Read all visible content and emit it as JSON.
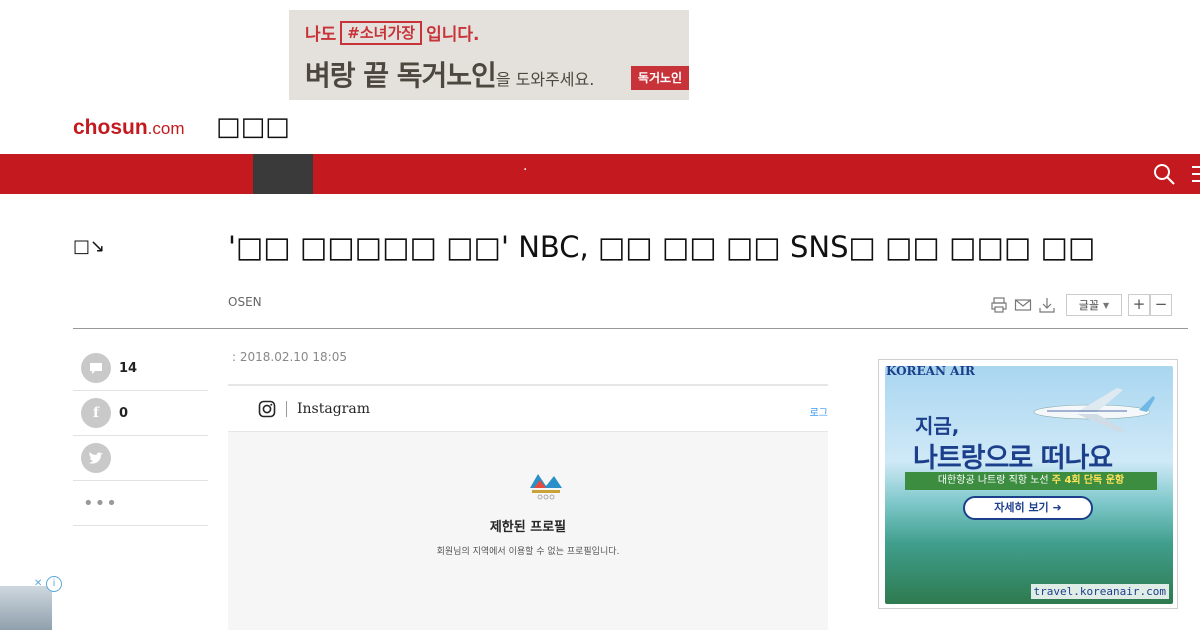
{
  "top_ad": {
    "line1_prefix": "나도",
    "line1_tag": "#소녀가장",
    "line1_suffix": "입니다.",
    "line2_main": "벼랑 끝 독거노인",
    "line2_tail": "을 도와주세요.",
    "button": "독거노인"
  },
  "header": {
    "logo_main": "chosun",
    "logo_domain": ".com",
    "section_title": "□□□"
  },
  "nav": {
    "dot_item": "·"
  },
  "article": {
    "side_label": "□↘",
    "headline": "'□□ □□□□□ □□' NBC, □□ □□ □□ SNS□ □□ □□□ □□",
    "source": "OSEN",
    "date": ": 2018.02.10 18:05",
    "font_label": "글꼴"
  },
  "share": {
    "comments_count": "14",
    "facebook_count": "0",
    "more": "•••"
  },
  "embed": {
    "brand": "Instagram",
    "login": "로그",
    "profile_title": "제한된 프로필",
    "profile_desc": "회원님의 지역에서 이용할 수 없는 프로필입니다."
  },
  "right_ad": {
    "logo": "KOREAN AIR",
    "line1": "지금,",
    "line2": "나트랑으로 떠나요",
    "ribbon_prefix": "대한항공 나트랑 직항 노선",
    "ribbon_highlight": "주 4회",
    "ribbon_suffix": "단독 운항",
    "button": "자세히 보기 ➜",
    "url": "travel.koreanair.com"
  },
  "colors": {
    "brand_red": "#c41a1f",
    "korean_air_blue": "#1c3f8c"
  }
}
